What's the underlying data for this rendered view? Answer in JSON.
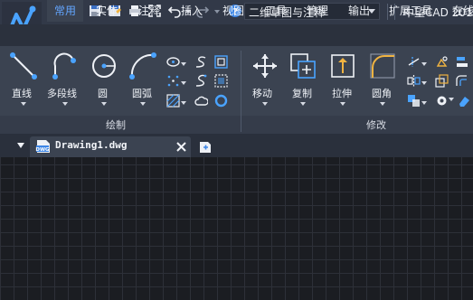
{
  "app": {
    "title": "中望CAD 2018",
    "workspace": "二维草图与注释"
  },
  "quick_access": [
    "new-icon",
    "open-icon",
    "save-icon",
    "save-as-icon",
    "print-icon",
    "fullscreen-icon",
    "undo-icon",
    "redo-icon",
    "help-icon"
  ],
  "ribbon_tabs": [
    {
      "label": "常用",
      "active": true
    },
    {
      "label": "实体"
    },
    {
      "label": "注释"
    },
    {
      "label": "插入"
    },
    {
      "label": "视图"
    },
    {
      "label": "工具"
    },
    {
      "label": "管理"
    },
    {
      "label": "输出"
    },
    {
      "label": "扩展工具"
    },
    {
      "label": "在线"
    }
  ],
  "draw_panel": {
    "title": "绘制",
    "tools": [
      {
        "label": "直线"
      },
      {
        "label": "多段线"
      },
      {
        "label": "圆"
      },
      {
        "label": "圆弧"
      }
    ]
  },
  "modify_panel": {
    "title": "修改",
    "tools": [
      {
        "label": "移动"
      },
      {
        "label": "复制"
      },
      {
        "label": "拉伸"
      },
      {
        "label": "圆角"
      }
    ]
  },
  "document": {
    "tab_name": "Drawing1.dwg",
    "file_badge": "DWG"
  },
  "colors": {
    "accent": "#63a6ff",
    "ribbon_bg": "#3b4351",
    "canvas_bg": "#1b1d22"
  }
}
